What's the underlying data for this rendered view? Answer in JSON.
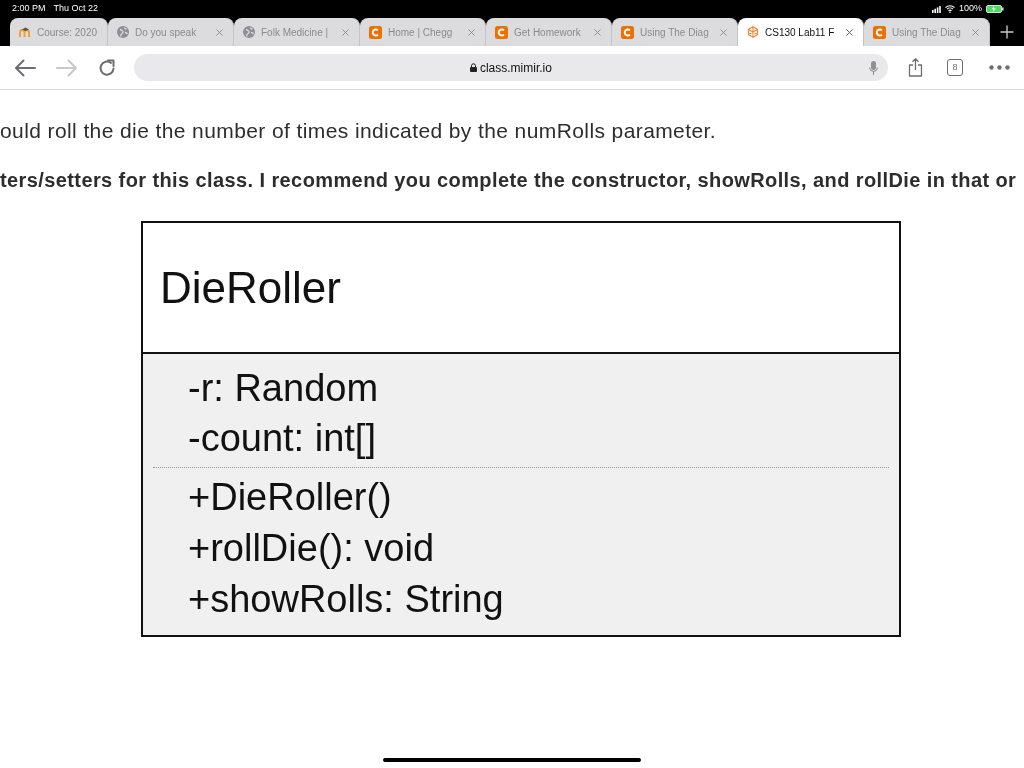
{
  "status_bar": {
    "time": "2:00 PM",
    "date": "Thu Oct 22",
    "battery": "100%"
  },
  "tabs": [
    {
      "kind": "moodle",
      "title": "Course: 2020",
      "close_shown": false,
      "selected": false
    },
    {
      "kind": "globe",
      "title": "Do you speak",
      "close_shown": true,
      "selected": false
    },
    {
      "kind": "globe",
      "title": "Folk Medicine |",
      "close_shown": true,
      "selected": false
    },
    {
      "kind": "chegg",
      "title": "Home | Chegg",
      "close_shown": true,
      "selected": false
    },
    {
      "kind": "chegg",
      "title": "Get Homework",
      "close_shown": true,
      "selected": false
    },
    {
      "kind": "chegg",
      "title": "Using The Diag",
      "close_shown": true,
      "selected": false
    },
    {
      "kind": "mimir",
      "title": "CS130 Lab11 F",
      "close_shown": true,
      "selected": true
    },
    {
      "kind": "chegg",
      "title": "Using The Diag",
      "close_shown": true,
      "selected": false
    }
  ],
  "navigation": [
    {
      "kind": "back",
      "disabled": false
    },
    {
      "kind": "forward",
      "disabled": true
    },
    {
      "kind": "reload",
      "disabled": false
    }
  ],
  "address_bar": {
    "url": "class.mimir.io"
  },
  "tab_count": "8",
  "content": {
    "paragraphs": [
      {
        "text": "ould roll the die the number of times indicated by the numRolls parameter.",
        "bold": false
      },
      {
        "text": "ters/setters for this class. I recommend you complete the constructor, showRolls, and rollDie in that or",
        "bold": true
      }
    ],
    "uml_class": {
      "name": "DieRoller",
      "attributes": [
        "-r: Random",
        "-count: int[]"
      ],
      "methods": [
        "+DieRoller()",
        "+rollDie(): void",
        "+showRolls: String"
      ]
    }
  }
}
